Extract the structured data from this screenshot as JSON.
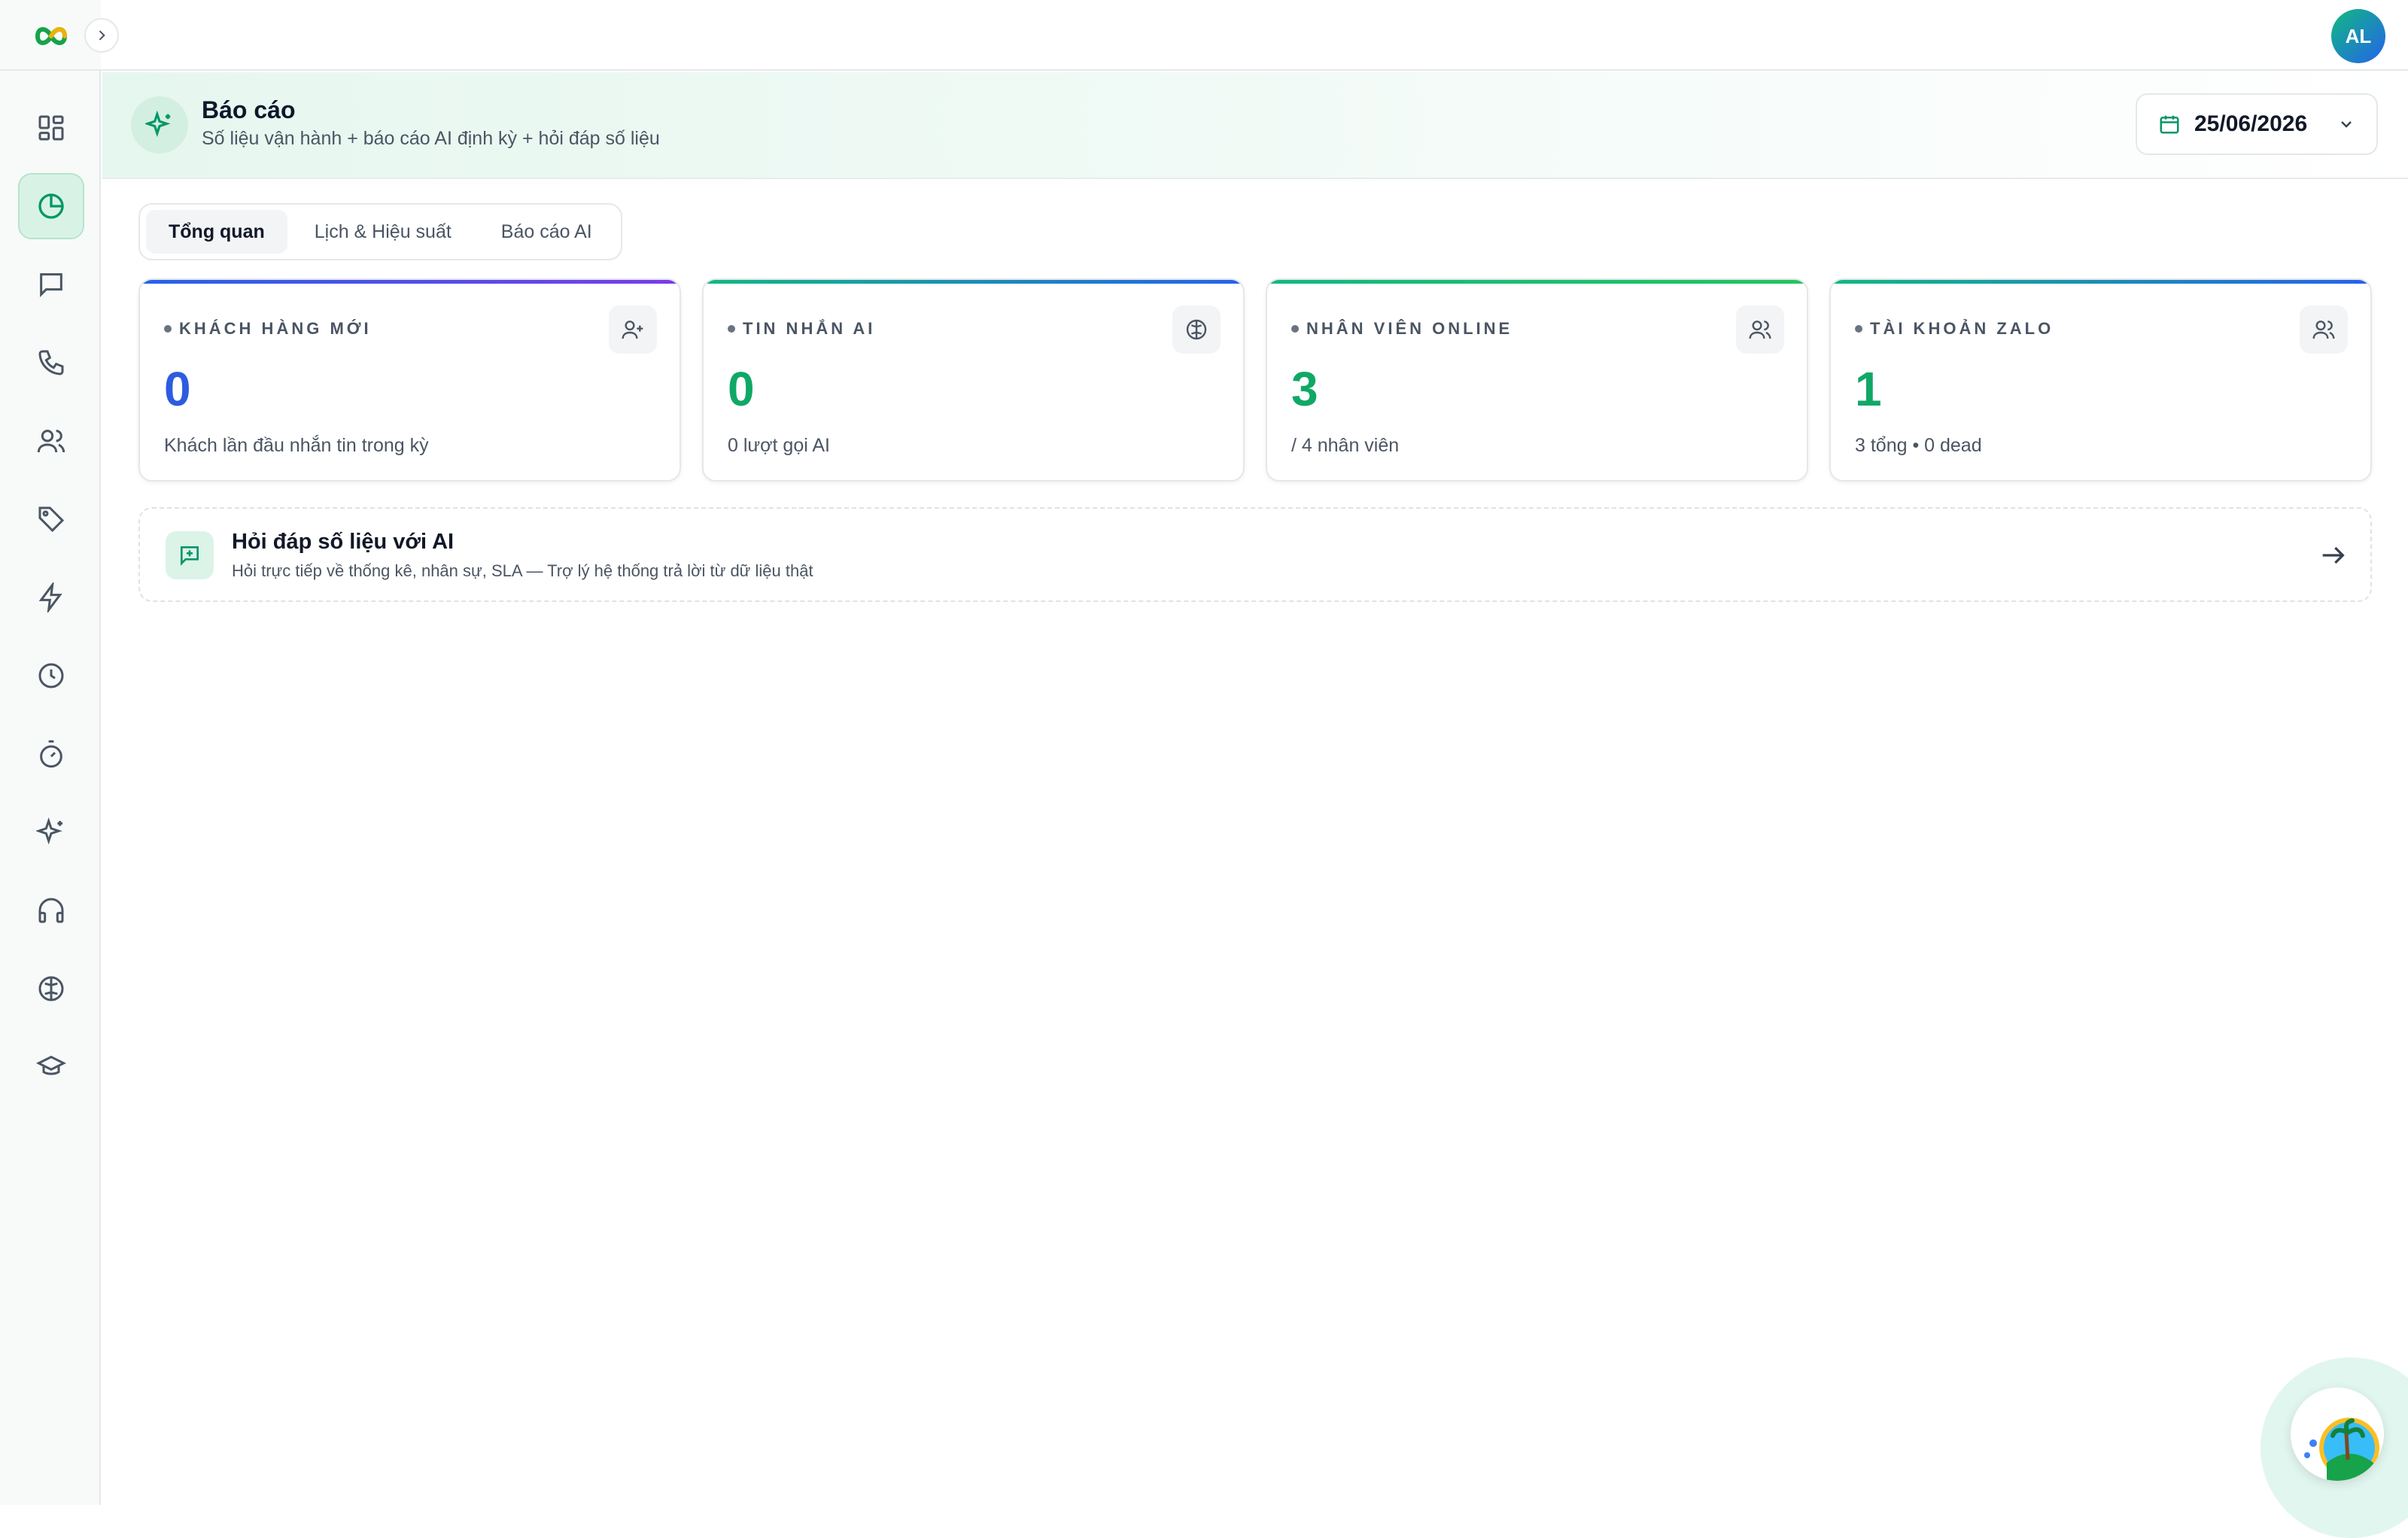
{
  "user": {
    "initials": "AL"
  },
  "header": {
    "title": "Báo cáo",
    "subtitle": "Số liệu vận hành + báo cáo AI định kỳ + hỏi đáp số liệu",
    "date": "25/06/2026"
  },
  "tabs": [
    {
      "label": "Tổng quan"
    },
    {
      "label": "Lịch & Hiệu suất"
    },
    {
      "label": "Báo cáo AI"
    }
  ],
  "cards": [
    {
      "label": "KHÁCH HÀNG MỚI",
      "value": "0",
      "note": "Khách lần đầu nhắn tin trong kỳ",
      "icon": "user-plus-icon",
      "value_color": "#2c5ce0",
      "bar": "linear-gradient(90deg,#2563eb,#7c3aed)"
    },
    {
      "label": "TIN NHẮN AI",
      "value": "0",
      "note": "0 lượt gọi AI",
      "icon": "brain-icon",
      "value_color": "#10a866",
      "bar": "linear-gradient(90deg,#10b981,#2563eb)"
    },
    {
      "label": "NHÂN VIÊN ONLINE",
      "value": "3",
      "note": "/ 4 nhân viên",
      "icon": "users-icon",
      "value_color": "#10a866",
      "bar": "linear-gradient(90deg,#10b981,#22c55e)"
    },
    {
      "label": "TÀI KHOẢN ZALO",
      "value": "1",
      "note": "3 tổng • 0 dead",
      "icon": "users-icon",
      "value_color": "#10a866",
      "bar": "linear-gradient(90deg,#10b981,#2563eb)"
    }
  ],
  "ai_qa": {
    "title": "Hỏi đáp số liệu với AI",
    "subtitle": "Hỏi trực tiếp về thống kê, nhân sự, SLA — Trợ lý hệ thống trả lời từ dữ liệu thật"
  },
  "sidebar": {
    "items": [
      {
        "icon": "dashboard-icon"
      },
      {
        "icon": "pie-chart-icon",
        "active": true
      },
      {
        "icon": "message-icon"
      },
      {
        "icon": "phone-icon"
      },
      {
        "icon": "users-icon"
      },
      {
        "icon": "tag-icon"
      },
      {
        "icon": "zap-icon"
      },
      {
        "icon": "clock-icon"
      },
      {
        "icon": "timer-icon"
      },
      {
        "icon": "sparkles-icon"
      },
      {
        "icon": "headphones-icon"
      },
      {
        "icon": "brain-icon"
      },
      {
        "icon": "graduation-cap-icon"
      }
    ]
  },
  "colors": {
    "accent": "#10b981",
    "primary_blue": "#2563eb",
    "purple": "#7c3aed"
  }
}
